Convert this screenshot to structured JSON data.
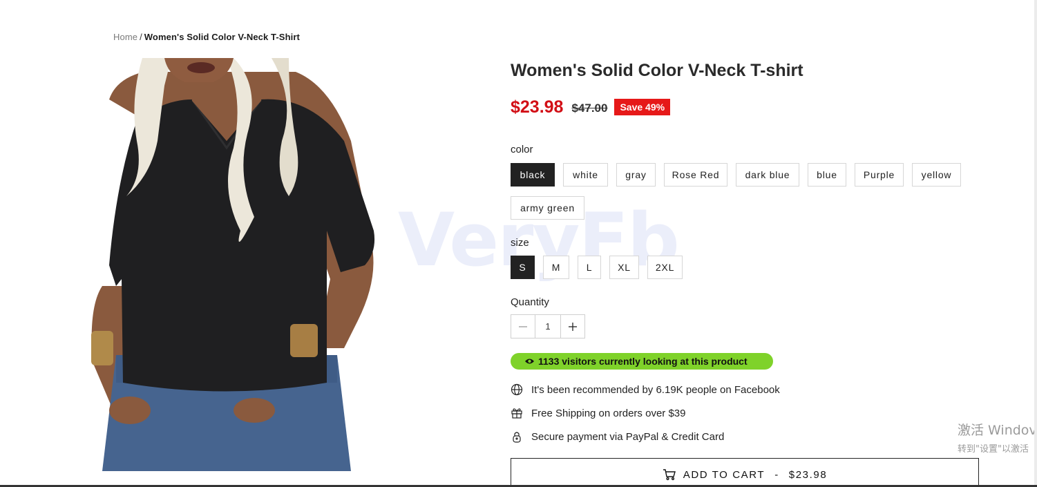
{
  "breadcrumb": {
    "home": "Home",
    "separator": "/",
    "current": "Women's Solid Color V-Neck T-Shirt"
  },
  "product": {
    "title": "Women's Solid Color V-Neck T-shirt",
    "price": "$23.98",
    "compare_price": "$47.00",
    "save_badge": "Save 49%"
  },
  "watermark": "VeryFb",
  "color": {
    "label": "color",
    "selected": "black",
    "options": [
      "black",
      "white",
      "gray",
      "Rose Red",
      "dark blue",
      "blue",
      "Purple",
      "yellow",
      "army green"
    ]
  },
  "size": {
    "label": "size",
    "selected": "S",
    "options": [
      "S",
      "M",
      "L",
      "XL",
      "2XL"
    ]
  },
  "quantity": {
    "label": "Quantity",
    "value": "1"
  },
  "visitors_text": "1133 visitors currently looking at this product",
  "features": [
    {
      "icon": "globe-icon",
      "text": "It's been recommended by 6.19K people on Facebook"
    },
    {
      "icon": "gift-box-icon",
      "text": "Free Shipping on orders over $39"
    },
    {
      "icon": "lock-icon",
      "text": "Secure payment via PayPal & Credit Card"
    }
  ],
  "add_to_cart": {
    "label": "ADD TO CART",
    "separator": "-",
    "price": "$23.98"
  },
  "os_overlay": {
    "line1": "激活 Windov",
    "line2": "转到\"设置\"以激活"
  },
  "colors": {
    "sale_red": "#d20f16",
    "badge_red": "#e61919",
    "visitor_green": "#7fd22a",
    "selected_dark": "#222222"
  }
}
